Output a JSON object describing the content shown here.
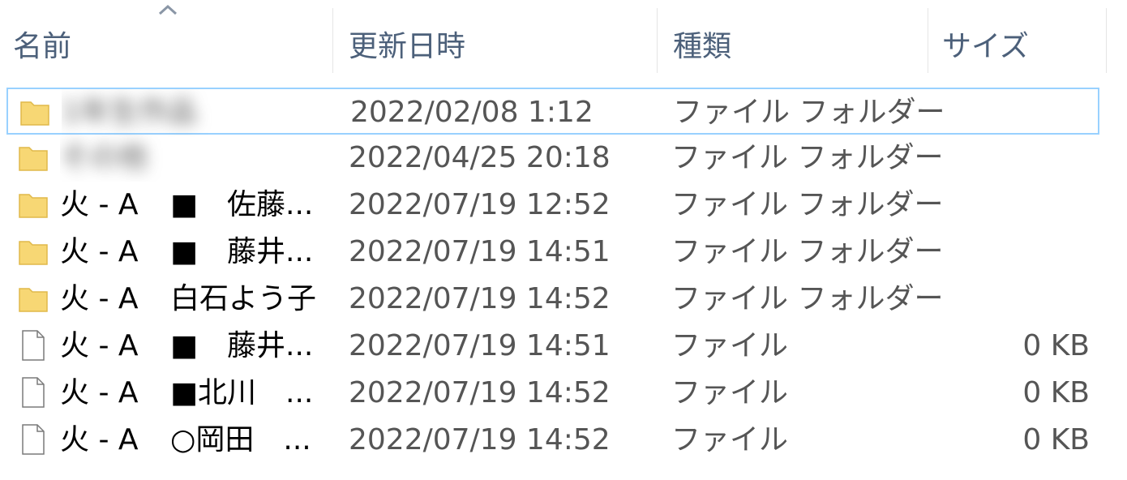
{
  "columns": {
    "name": "名前",
    "modified": "更新日時",
    "type": "種類",
    "size": "サイズ"
  },
  "sort_indicator": "chevron-up-icon",
  "colors": {
    "folder": "#f7d774",
    "selection_border": "#99d1ff",
    "header_text": "#4c607a"
  },
  "rows": [
    {
      "icon": "folder-icon",
      "prefix": "",
      "name": "1年生作品",
      "modified": "2022/02/08 1:12",
      "type": "ファイル フォルダー",
      "size": ""
    },
    {
      "icon": "folder-icon",
      "prefix": "",
      "name": "その他",
      "modified": "2022/04/25 20:18",
      "type": "ファイル フォルダー",
      "size": ""
    },
    {
      "icon": "folder-icon",
      "prefix": "火 - A",
      "name": "■　佐藤...",
      "modified": "2022/07/19 12:52",
      "type": "ファイル フォルダー",
      "size": ""
    },
    {
      "icon": "folder-icon",
      "prefix": "火 - A",
      "name": "■　藤井...",
      "modified": "2022/07/19 14:51",
      "type": "ファイル フォルダー",
      "size": ""
    },
    {
      "icon": "folder-icon",
      "prefix": "火 - A",
      "name": "白石よう子",
      "modified": "2022/07/19 14:52",
      "type": "ファイル フォルダー",
      "size": ""
    },
    {
      "icon": "file-icon",
      "prefix": "火 - A",
      "name": "■　藤井...",
      "modified": "2022/07/19 14:51",
      "type": "ファイル",
      "size": "0 KB"
    },
    {
      "icon": "file-icon",
      "prefix": "火 - A",
      "name": "■北川　...",
      "modified": "2022/07/19 14:52",
      "type": "ファイル",
      "size": "0 KB"
    },
    {
      "icon": "file-icon",
      "prefix": "火 - A",
      "name": "○岡田　...",
      "modified": "2022/07/19 14:52",
      "type": "ファイル",
      "size": "0 KB"
    }
  ]
}
